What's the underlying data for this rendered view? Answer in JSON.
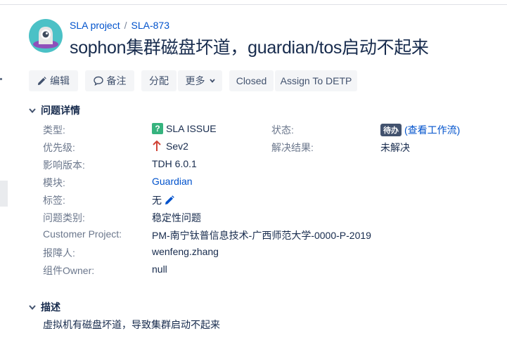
{
  "breadcrumb": {
    "project": "SLA project",
    "separator": "/",
    "issue_key": "SLA-873"
  },
  "issue": {
    "title": "sophon集群磁盘坏道，guardian/tos启动不起来"
  },
  "toolbar": {
    "edit": "编辑",
    "comment": "备注",
    "assign": "分配",
    "more": "更多",
    "closed": "Closed",
    "assign_to": "Assign To DETP"
  },
  "details": {
    "heading": "问题详情",
    "fields": [
      {
        "label": "类型:",
        "value": "SLA ISSUE"
      },
      {
        "label": "优先级:",
        "value": "Sev2"
      },
      {
        "label": "影响版本:",
        "value": "TDH 6.0.1"
      },
      {
        "label": "模块:",
        "value": "Guardian"
      },
      {
        "label": "标签:",
        "value": "无"
      },
      {
        "label": "问题类别:",
        "value": "稳定性问题"
      },
      {
        "label": "Customer Project:",
        "value": "PM-南宁钛普信息技术-广西师范大学-0000-P-2019"
      },
      {
        "label": "报障人:",
        "value": "wenfeng.zhang"
      },
      {
        "label": "组件Owner:",
        "value": "null"
      }
    ],
    "status": {
      "label": "状态:",
      "value": "待办",
      "link": "(查看工作流)"
    },
    "resolution": {
      "label": "解决结果:",
      "value": "未解决"
    }
  },
  "description": {
    "heading": "描述",
    "text": "虚拟机有磁盘坏道，导致集群启动不起来"
  },
  "colors": {
    "link": "#0052cc",
    "text": "#172b4d",
    "muted": "#6b778c",
    "button_bg": "#f4f5f7",
    "lozenge": "#42526e",
    "type_icon": "#36b37e",
    "priority": "#d04437",
    "avatar_bg": "#4bc1c6",
    "avatar_accent": "#8f4fba"
  },
  "icons": {
    "avatar": "project-avatar",
    "edit": "pencil-icon",
    "comment": "comment-icon",
    "more": "chevron-down-icon",
    "type": "question-icon",
    "priority": "arrow-up-icon",
    "labels": "pencil-icon",
    "section": "chevron-down-icon"
  }
}
